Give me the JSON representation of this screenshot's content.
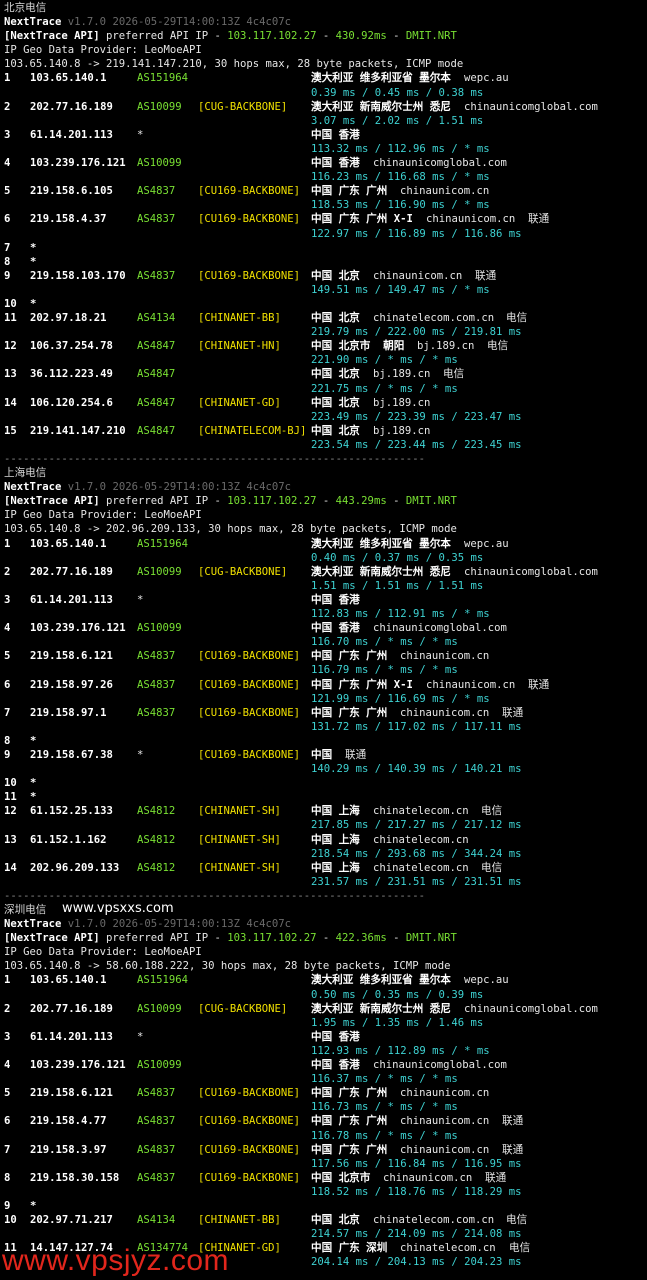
{
  "watermark_mid": "www.vpsxxs.com",
  "watermark_bottom": "www.vpsjyz.com",
  "sections": [
    {
      "title": "北京电信",
      "app": "NextTrace",
      "version": "v1.7.0 2026-05-29T14:00:13Z 4c4c07c",
      "api_label": "[NextTrace API]",
      "api_text": " preferred API IP - ",
      "api_ip": "103.117.102.27",
      "api_dash": " - ",
      "api_ms": "430.92ms",
      "api_node": "DMIT.NRT",
      "geo": "IP Geo Data Provider: LeoMoeAPI",
      "trace": "103.65.140.8 -> 219.141.147.210, 30 hops max, 28 byte packets, ICMP mode",
      "hops": [
        {
          "n": "1",
          "ip": "103.65.140.1",
          "as": "AS151964",
          "tag": "",
          "geo": "澳大利亚 维多利亚省 墨尔本",
          "host": "wepc.au",
          "isp": "",
          "rtt": "0.39 ms / 0.45 ms / 0.38 ms"
        },
        {
          "n": "2",
          "ip": "202.77.16.189",
          "as": "AS10099",
          "tag": "[CUG-BACKBONE]",
          "geo": "澳大利亚 新南威尔士州 悉尼",
          "host": "chinaunicomglobal.com",
          "isp": "",
          "rtt": "3.07 ms / 2.02 ms / 1.51 ms"
        },
        {
          "n": "3",
          "ip": "61.14.201.113",
          "as": "*",
          "tag": "",
          "geo": "中国 香港",
          "host": "",
          "isp": "",
          "rtt": "113.32 ms / 112.96 ms / * ms"
        },
        {
          "n": "4",
          "ip": "103.239.176.121",
          "as": "AS10099",
          "tag": "",
          "geo": "中国 香港",
          "host": "chinaunicomglobal.com",
          "isp": "",
          "rtt": "116.23 ms / 116.68 ms / * ms"
        },
        {
          "n": "5",
          "ip": "219.158.6.105",
          "as": "AS4837",
          "tag": "[CU169-BACKBONE]",
          "geo": "中国 广东 广州",
          "host": "chinaunicom.cn",
          "isp": "",
          "rtt": "118.53 ms / 116.90 ms / * ms"
        },
        {
          "n": "6",
          "ip": "219.158.4.37",
          "as": "AS4837",
          "tag": "[CU169-BACKBONE]",
          "geo": "中国 广东 广州 X-I",
          "host": "chinaunicom.cn",
          "isp": "联通",
          "rtt": "122.97 ms / 116.89 ms / 116.86 ms"
        },
        {
          "n": "7",
          "ip": "*",
          "as": "",
          "tag": "",
          "geo": "",
          "host": "",
          "isp": "",
          "rtt": ""
        },
        {
          "n": "8",
          "ip": "*",
          "as": "",
          "tag": "",
          "geo": "",
          "host": "",
          "isp": "",
          "rtt": ""
        },
        {
          "n": "9",
          "ip": "219.158.103.170",
          "as": "AS4837",
          "tag": "[CU169-BACKBONE]",
          "geo": "中国 北京",
          "host": "chinaunicom.cn",
          "isp": "联通",
          "rtt": "149.51 ms / 149.47 ms / * ms"
        },
        {
          "n": "10",
          "ip": "*",
          "as": "",
          "tag": "",
          "geo": "",
          "host": "",
          "isp": "",
          "rtt": ""
        },
        {
          "n": "11",
          "ip": "202.97.18.21",
          "as": "AS4134",
          "tag": "[CHINANET-BB]",
          "geo": "中国 北京",
          "host": "chinatelecom.com.cn",
          "isp": "电信",
          "rtt": "219.79 ms / 222.00 ms / 219.81 ms"
        },
        {
          "n": "12",
          "ip": "106.37.254.78",
          "as": "AS4847",
          "tag": "[CHINANET-HN]",
          "geo": "中国 北京市  朝阳",
          "host": "bj.189.cn",
          "isp": "电信",
          "rtt": "221.90 ms / * ms / * ms"
        },
        {
          "n": "13",
          "ip": "36.112.223.49",
          "as": "AS4847",
          "tag": "",
          "geo": "中国 北京",
          "host": "bj.189.cn",
          "isp": "电信",
          "rtt": "221.75 ms / * ms / * ms"
        },
        {
          "n": "14",
          "ip": "106.120.254.6",
          "as": "AS4847",
          "tag": "[CHINANET-GD]",
          "geo": "中国 北京",
          "host": "bj.189.cn",
          "isp": "",
          "rtt": "223.49 ms / 223.39 ms / 223.47 ms"
        },
        {
          "n": "15",
          "ip": "219.141.147.210",
          "as": "AS4847",
          "tag": "[CHINATELECOM-BJ]",
          "geo": "中国 北京",
          "host": "bj.189.cn",
          "isp": "",
          "rtt": "223.54 ms / 223.44 ms / 223.45 ms"
        }
      ],
      "separator": "------------------------------------------------------------------"
    },
    {
      "title": "上海电信",
      "app": "NextTrace",
      "version": "v1.7.0 2026-05-29T14:00:13Z 4c4c07c",
      "api_label": "[NextTrace API]",
      "api_text": " preferred API IP - ",
      "api_ip": "103.117.102.27",
      "api_dash": " - ",
      "api_ms": "443.29ms",
      "api_node": "DMIT.NRT",
      "geo": "IP Geo Data Provider: LeoMoeAPI",
      "trace": "103.65.140.8 -> 202.96.209.133, 30 hops max, 28 byte packets, ICMP mode",
      "hops": [
        {
          "n": "1",
          "ip": "103.65.140.1",
          "as": "AS151964",
          "tag": "",
          "geo": "澳大利亚 维多利亚省 墨尔本",
          "host": "wepc.au",
          "isp": "",
          "rtt": "0.40 ms / 0.37 ms / 0.35 ms"
        },
        {
          "n": "2",
          "ip": "202.77.16.189",
          "as": "AS10099",
          "tag": "[CUG-BACKBONE]",
          "geo": "澳大利亚 新南威尔士州 悉尼",
          "host": "chinaunicomglobal.com",
          "isp": "",
          "rtt": "1.51 ms / 1.51 ms / 1.51 ms"
        },
        {
          "n": "3",
          "ip": "61.14.201.113",
          "as": "*",
          "tag": "",
          "geo": "中国 香港",
          "host": "",
          "isp": "",
          "rtt": "112.83 ms / 112.91 ms / * ms"
        },
        {
          "n": "4",
          "ip": "103.239.176.121",
          "as": "AS10099",
          "tag": "",
          "geo": "中国 香港",
          "host": "chinaunicomglobal.com",
          "isp": "",
          "rtt": "116.70 ms / * ms / * ms"
        },
        {
          "n": "5",
          "ip": "219.158.6.121",
          "as": "AS4837",
          "tag": "[CU169-BACKBONE]",
          "geo": "中国 广东 广州",
          "host": "chinaunicom.cn",
          "isp": "",
          "rtt": "116.79 ms / * ms / * ms"
        },
        {
          "n": "6",
          "ip": "219.158.97.26",
          "as": "AS4837",
          "tag": "[CU169-BACKBONE]",
          "geo": "中国 广东 广州 X-I",
          "host": "chinaunicom.cn",
          "isp": "联通",
          "rtt": "121.99 ms / 116.69 ms / * ms"
        },
        {
          "n": "7",
          "ip": "219.158.97.1",
          "as": "AS4837",
          "tag": "[CU169-BACKBONE]",
          "geo": "中国 广东 广州",
          "host": "chinaunicom.cn",
          "isp": "联通",
          "rtt": "131.72 ms / 117.02 ms / 117.11 ms"
        },
        {
          "n": "8",
          "ip": "*",
          "as": "",
          "tag": "",
          "geo": "",
          "host": "",
          "isp": "",
          "rtt": ""
        },
        {
          "n": "9",
          "ip": "219.158.67.38",
          "as": "*",
          "tag": "[CU169-BACKBONE]",
          "geo": "中国",
          "host": "",
          "isp": "联通",
          "rtt": "140.29 ms / 140.39 ms / 140.21 ms"
        },
        {
          "n": "10",
          "ip": "*",
          "as": "",
          "tag": "",
          "geo": "",
          "host": "",
          "isp": "",
          "rtt": ""
        },
        {
          "n": "11",
          "ip": "*",
          "as": "",
          "tag": "",
          "geo": "",
          "host": "",
          "isp": "",
          "rtt": ""
        },
        {
          "n": "12",
          "ip": "61.152.25.133",
          "as": "AS4812",
          "tag": "[CHINANET-SH]",
          "geo": "中国 上海",
          "host": "chinatelecom.cn",
          "isp": "电信",
          "rtt": "217.85 ms / 217.27 ms / 217.12 ms"
        },
        {
          "n": "13",
          "ip": "61.152.1.162",
          "as": "AS4812",
          "tag": "[CHINANET-SH]",
          "geo": "中国 上海",
          "host": "chinatelecom.cn",
          "isp": "",
          "rtt": "218.54 ms / 293.68 ms / 344.24 ms"
        },
        {
          "n": "14",
          "ip": "202.96.209.133",
          "as": "AS4812",
          "tag": "[CHINANET-SH]",
          "geo": "中国 上海",
          "host": "chinatelecom.cn",
          "isp": "电信",
          "rtt": "231.57 ms / 231.51 ms / 231.51 ms"
        }
      ],
      "separator": "------------------------------------------------------------------"
    },
    {
      "title": "深圳电信",
      "app": "NextTrace",
      "version": "v1.7.0 2026-05-29T14:00:13Z 4c4c07c",
      "api_label": "[NextTrace API]",
      "api_text": " preferred API IP - ",
      "api_ip": "103.117.102.27",
      "api_dash": " - ",
      "api_ms": "422.36ms",
      "api_node": "DMIT.NRT",
      "geo": "IP Geo Data Provider: LeoMoeAPI",
      "trace": "103.65.140.8 -> 58.60.188.222, 30 hops max, 28 byte packets, ICMP mode",
      "hops": [
        {
          "n": "1",
          "ip": "103.65.140.1",
          "as": "AS151964",
          "tag": "",
          "geo": "澳大利亚 维多利亚省 墨尔本",
          "host": "wepc.au",
          "isp": "",
          "rtt": "0.50 ms / 0.35 ms / 0.39 ms"
        },
        {
          "n": "2",
          "ip": "202.77.16.189",
          "as": "AS10099",
          "tag": "[CUG-BACKBONE]",
          "geo": "澳大利亚 新南威尔士州 悉尼",
          "host": "chinaunicomglobal.com",
          "isp": "",
          "rtt": "1.95 ms / 1.35 ms / 1.46 ms"
        },
        {
          "n": "3",
          "ip": "61.14.201.113",
          "as": "*",
          "tag": "",
          "geo": "中国 香港",
          "host": "",
          "isp": "",
          "rtt": "112.93 ms / 112.89 ms / * ms"
        },
        {
          "n": "4",
          "ip": "103.239.176.121",
          "as": "AS10099",
          "tag": "",
          "geo": "中国 香港",
          "host": "chinaunicomglobal.com",
          "isp": "",
          "rtt": "116.37 ms / * ms / * ms"
        },
        {
          "n": "5",
          "ip": "219.158.6.121",
          "as": "AS4837",
          "tag": "[CU169-BACKBONE]",
          "geo": "中国 广东 广州",
          "host": "chinaunicom.cn",
          "isp": "",
          "rtt": "116.73 ms / * ms / * ms"
        },
        {
          "n": "6",
          "ip": "219.158.4.77",
          "as": "AS4837",
          "tag": "[CU169-BACKBONE]",
          "geo": "中国 广东 广州",
          "host": "chinaunicom.cn",
          "isp": "联通",
          "rtt": "116.78 ms / * ms / * ms"
        },
        {
          "n": "7",
          "ip": "219.158.3.97",
          "as": "AS4837",
          "tag": "[CU169-BACKBONE]",
          "geo": "中国 广东 广州",
          "host": "chinaunicom.cn",
          "isp": "联通",
          "rtt": "117.56 ms / 116.84 ms / 116.95 ms"
        },
        {
          "n": "8",
          "ip": "219.158.30.158",
          "as": "AS4837",
          "tag": "[CU169-BACKBONE]",
          "geo": "中国 北京市",
          "host": "chinaunicom.cn",
          "isp": "联通",
          "rtt": "118.52 ms / 118.76 ms / 118.29 ms"
        },
        {
          "n": "9",
          "ip": "*",
          "as": "",
          "tag": "",
          "geo": "",
          "host": "",
          "isp": "",
          "rtt": ""
        },
        {
          "n": "10",
          "ip": "202.97.71.217",
          "as": "AS4134",
          "tag": "[CHINANET-BB]",
          "geo": "中国 北京",
          "host": "chinatelecom.com.cn",
          "isp": "电信",
          "rtt": "214.57 ms / 214.09 ms / 214.08 ms"
        },
        {
          "n": "11",
          "ip": "14.147.127.74",
          "as": "AS134774",
          "tag": "[CHINANET-GD]",
          "geo": "中国 广东 深圳",
          "host": "chinatelecom.cn",
          "isp": "电信",
          "rtt": "204.14 ms / 204.13 ms / 204.23 ms"
        }
      ],
      "separator": ""
    }
  ]
}
